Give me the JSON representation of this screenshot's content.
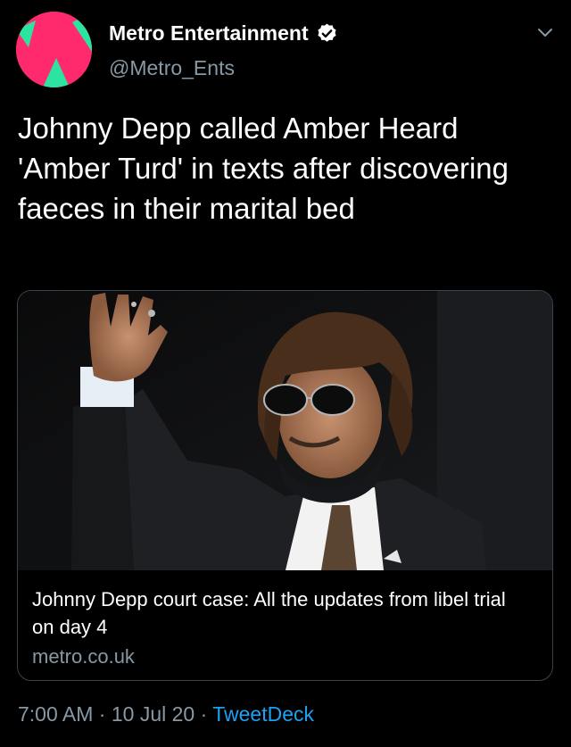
{
  "tweet": {
    "author": {
      "display_name": "Metro Entertainment",
      "handle": "@Metro_Ents",
      "verified": true,
      "avatar_icon": "metro-logo-icon"
    },
    "text": "Johnny Depp called Amber Heard 'Amber Turd' in texts after discovering faeces in their marital bed",
    "card": {
      "image_alt": "Photo of Johnny Depp waving",
      "title": "Johnny Depp court case: All the updates from libel trial on day 4",
      "domain": "metro.co.uk"
    },
    "time": "7:00 AM",
    "separator": " · ",
    "date": "10 Jul 20",
    "source": "TweetDeck"
  },
  "colors": {
    "background": "#000000",
    "text": "#ffffff",
    "secondary_text": "#8899a6",
    "link": "#1da1f2",
    "verified_badge": "#ffffff",
    "card_border": "#38444d",
    "avatar_pink": "#ff2a6d",
    "avatar_green": "#2ce3a0"
  }
}
